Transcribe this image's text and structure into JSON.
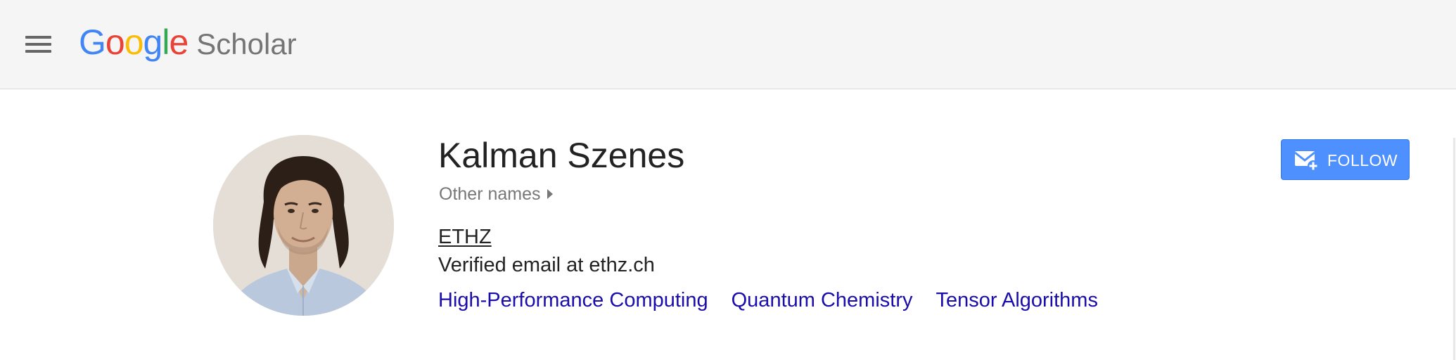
{
  "header": {
    "menu_icon": "hamburger-menu-icon",
    "logo": {
      "google_letters": [
        "G",
        "o",
        "o",
        "g",
        "l",
        "e"
      ],
      "product": "Scholar",
      "colors": [
        "#4285f4",
        "#ea4335",
        "#fbbc05",
        "#4285f4",
        "#34a853",
        "#ea4335"
      ]
    }
  },
  "profile": {
    "name": "Kalman Szenes",
    "other_names_label": "Other names",
    "affiliation": "ETHZ",
    "email_line": "Verified email at ethz.ch",
    "interests": [
      "High-Performance Computing",
      "Quantum Chemistry",
      "Tensor Algorithms"
    ],
    "avatar_icon": "profile-photo"
  },
  "follow": {
    "label": "FOLLOW",
    "icon": "envelope-plus-icon",
    "color": "#4d90fe"
  },
  "colors": {
    "header_bg": "#f5f5f5",
    "link": "#1a0dab",
    "text": "#222222",
    "muted": "#777777"
  }
}
